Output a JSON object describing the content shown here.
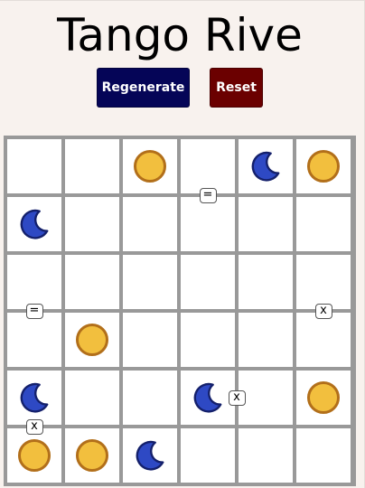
{
  "title": "Tango Rive",
  "buttons": {
    "regenerate": "Regenerate",
    "reset": "Reset"
  },
  "colors": {
    "regenerate_bg": "#050557",
    "reset_bg": "#6b0000",
    "sun": "#f2bf3e",
    "moon": "#2e49c4",
    "grid": "#999999"
  },
  "grid": [
    [
      "",
      "",
      "sun",
      "",
      "moon",
      "sun"
    ],
    [
      "moon",
      "",
      "",
      "",
      "",
      ""
    ],
    [
      "",
      "",
      "",
      "",
      "",
      ""
    ],
    [
      "",
      "sun",
      "",
      "",
      "",
      ""
    ],
    [
      "moon",
      "",
      "",
      "moon",
      "",
      "sun"
    ],
    [
      "sun",
      "sun",
      "moon",
      "",
      "",
      ""
    ]
  ],
  "constraints": [
    {
      "between": [
        [
          0,
          3
        ],
        [
          1,
          3
        ]
      ],
      "symbol": "="
    },
    {
      "between": [
        [
          2,
          0
        ],
        [
          3,
          0
        ]
      ],
      "symbol": "="
    },
    {
      "between": [
        [
          2,
          5
        ],
        [
          3,
          5
        ]
      ],
      "symbol": "x"
    },
    {
      "between": [
        [
          4,
          3
        ],
        [
          4,
          4
        ]
      ],
      "symbol": "x"
    },
    {
      "between": [
        [
          4,
          0
        ],
        [
          5,
          0
        ]
      ],
      "symbol": "x"
    }
  ]
}
